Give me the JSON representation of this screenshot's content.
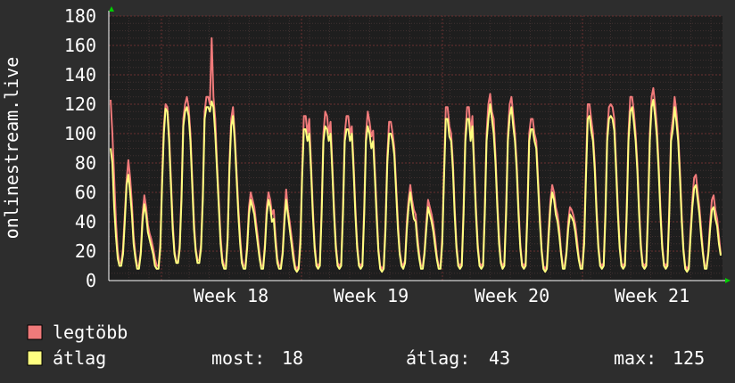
{
  "chart_data": {
    "type": "line",
    "ylabel": "onlinestream.live",
    "ylim": [
      0,
      180
    ],
    "y_ticks": [
      "0",
      "20",
      "40",
      "60",
      "80",
      "100",
      "120",
      "140",
      "160",
      "180"
    ],
    "x_ticks": [
      "Week 18",
      "Week 19",
      "Week 20",
      "Week 21"
    ],
    "grid": true,
    "legend_position": "bottom",
    "colors": {
      "background": "#2d2d2d",
      "plot_bg": "#1e1e1e",
      "grid": "#6a3030",
      "axis": "#ffffff",
      "arrow": "#00cc00"
    },
    "series": [
      {
        "name": "legtöbb",
        "color": "#f07a7a",
        "values": [
          123,
          100,
          70,
          40,
          20,
          12,
          12,
          22,
          45,
          68,
          82,
          70,
          52,
          30,
          18,
          10,
          10,
          20,
          45,
          58,
          50,
          38,
          32,
          28,
          22,
          15,
          10,
          10,
          25,
          70,
          105,
          120,
          118,
          100,
          70,
          40,
          20,
          13,
          13,
          25,
          60,
          110,
          120,
          125,
          118,
          100,
          70,
          40,
          22,
          14,
          14,
          25,
          60,
          115,
          125,
          125,
          120,
          165,
          125,
          110,
          80,
          55,
          30,
          15,
          10,
          10,
          30,
          80,
          110,
          118,
          100,
          75,
          50,
          30,
          15,
          10,
          10,
          25,
          50,
          60,
          55,
          50,
          40,
          30,
          18,
          10,
          10,
          25,
          50,
          60,
          55,
          45,
          48,
          30,
          15,
          10,
          10,
          20,
          45,
          62,
          48,
          40,
          30,
          20,
          10,
          8,
          10,
          30,
          75,
          112,
          112,
          100,
          110,
          80,
          50,
          25,
          12,
          10,
          12,
          50,
          100,
          115,
          112,
          100,
          108,
          80,
          50,
          25,
          12,
          10,
          12,
          50,
          100,
          112,
          112,
          100,
          105,
          80,
          50,
          25,
          12,
          10,
          12,
          50,
          100,
          115,
          108,
          98,
          102,
          75,
          48,
          22,
          10,
          8,
          10,
          40,
          85,
          108,
          108,
          100,
          90,
          65,
          40,
          20,
          12,
          10,
          14,
          40,
          55,
          65,
          55,
          48,
          45,
          30,
          18,
          10,
          10,
          20,
          40,
          55,
          50,
          45,
          38,
          28,
          16,
          10,
          10,
          30,
          75,
          118,
          118,
          105,
          100,
          80,
          50,
          25,
          12,
          10,
          12,
          50,
          100,
          118,
          118,
          100,
          112,
          80,
          50,
          25,
          12,
          10,
          12,
          50,
          100,
          120,
          127,
          115,
          110,
          85,
          55,
          30,
          14,
          10,
          12,
          50,
          100,
          120,
          125,
          112,
          100,
          80,
          50,
          25,
          12,
          10,
          12,
          50,
          100,
          110,
          110,
          100,
          95,
          70,
          45,
          22,
          10,
          8,
          10,
          35,
          55,
          65,
          60,
          50,
          45,
          35,
          20,
          10,
          10,
          20,
          40,
          50,
          48,
          44,
          38,
          28,
          16,
          10,
          10,
          30,
          75,
          120,
          120,
          110,
          100,
          80,
          50,
          25,
          12,
          10,
          12,
          50,
          100,
          118,
          120,
          118,
          110,
          80,
          50,
          25,
          12,
          10,
          12,
          50,
          100,
          125,
          125,
          115,
          100,
          80,
          50,
          25,
          12,
          10,
          12,
          50,
          100,
          125,
          131,
          120,
          105,
          80,
          50,
          25,
          12,
          10,
          12,
          50,
          100,
          110,
          125,
          115,
          100,
          75,
          45,
          22,
          10,
          8,
          10,
          35,
          55,
          70,
          72,
          60,
          50,
          35,
          20,
          10,
          10,
          20,
          40,
          55,
          58,
          48,
          42,
          30,
          18
        ]
      },
      {
        "name": "átlag",
        "color": "#ffff80",
        "values": [
          90,
          80,
          50,
          30,
          15,
          10,
          10,
          18,
          40,
          65,
          72,
          60,
          45,
          25,
          15,
          8,
          8,
          18,
          40,
          52,
          45,
          33,
          28,
          23,
          18,
          10,
          8,
          8,
          22,
          65,
          100,
          117,
          115,
          95,
          65,
          35,
          18,
          12,
          12,
          22,
          55,
          105,
          115,
          118,
          112,
          95,
          65,
          35,
          20,
          12,
          12,
          22,
          55,
          110,
          118,
          118,
          115,
          122,
          118,
          100,
          75,
          50,
          25,
          12,
          8,
          8,
          28,
          75,
          105,
          112,
          95,
          70,
          45,
          25,
          12,
          8,
          8,
          22,
          45,
          55,
          50,
          45,
          35,
          25,
          15,
          8,
          8,
          22,
          45,
          55,
          50,
          40,
          42,
          25,
          12,
          8,
          8,
          18,
          40,
          55,
          45,
          35,
          25,
          15,
          8,
          6,
          8,
          25,
          70,
          103,
          103,
          95,
          100,
          75,
          45,
          22,
          10,
          8,
          10,
          45,
          95,
          105,
          103,
          95,
          100,
          75,
          45,
          22,
          10,
          8,
          10,
          45,
          95,
          103,
          103,
          95,
          100,
          75,
          45,
          22,
          10,
          8,
          10,
          45,
          95,
          105,
          100,
          90,
          95,
          70,
          42,
          20,
          8,
          6,
          8,
          35,
          80,
          100,
          100,
          95,
          85,
          60,
          35,
          18,
          10,
          8,
          12,
          35,
          50,
          60,
          50,
          42,
          40,
          25,
          15,
          8,
          8,
          18,
          35,
          50,
          45,
          40,
          33,
          23,
          14,
          8,
          8,
          25,
          70,
          110,
          110,
          98,
          95,
          75,
          45,
          22,
          10,
          8,
          10,
          45,
          95,
          110,
          110,
          95,
          105,
          75,
          45,
          22,
          10,
          8,
          10,
          45,
          95,
          110,
          120,
          110,
          100,
          80,
          50,
          25,
          12,
          8,
          10,
          45,
          95,
          112,
          118,
          105,
          95,
          75,
          45,
          22,
          10,
          8,
          10,
          45,
          95,
          103,
          103,
          95,
          90,
          65,
          40,
          20,
          8,
          6,
          8,
          30,
          50,
          60,
          55,
          45,
          40,
          30,
          18,
          8,
          8,
          18,
          35,
          45,
          43,
          40,
          33,
          23,
          14,
          8,
          8,
          25,
          70,
          110,
          112,
          102,
          95,
          75,
          45,
          22,
          10,
          8,
          10,
          45,
          95,
          110,
          112,
          110,
          102,
          75,
          45,
          22,
          10,
          8,
          10,
          45,
          95,
          115,
          118,
          108,
          95,
          75,
          45,
          22,
          10,
          8,
          10,
          45,
          95,
          118,
          123,
          112,
          98,
          75,
          45,
          22,
          10,
          8,
          10,
          45,
          95,
          103,
          118,
          108,
          95,
          70,
          40,
          20,
          8,
          6,
          8,
          30,
          50,
          63,
          65,
          55,
          45,
          30,
          18,
          8,
          8,
          18,
          35,
          48,
          50,
          42,
          37,
          25,
          17
        ]
      }
    ]
  },
  "legend": {
    "items": [
      {
        "label": "legtöbb",
        "color": "#f07a7a"
      },
      {
        "label": "átlag",
        "color": "#ffff80"
      }
    ],
    "stats": {
      "most_label": "most:",
      "most_value": "18",
      "atlag_label": "átlag:",
      "atlag_value": "43",
      "max_label": "max:",
      "max_value": "125"
    }
  }
}
